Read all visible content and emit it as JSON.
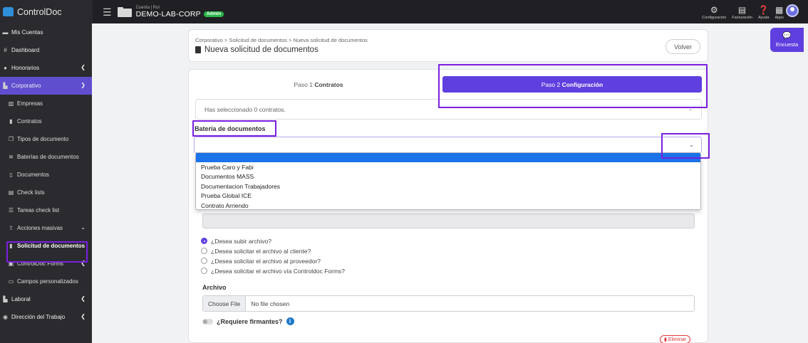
{
  "topbar": {
    "brand": "ControlDoc",
    "account_role": "Cuenta | Rol",
    "account_name": "DEMO-LAB-CORP",
    "account_badge": "Admin",
    "actions": [
      {
        "label": "Configuración",
        "icon": "gears-icon"
      },
      {
        "label": "Facturación",
        "icon": "invoice-icon"
      },
      {
        "label": "Ayuda",
        "icon": "help-icon"
      },
      {
        "label": "Apps",
        "icon": "grid-icon"
      }
    ]
  },
  "sidebar": {
    "items": [
      {
        "label": "Mis Cuentas"
      },
      {
        "label": "Dashboard"
      },
      {
        "label": "Honorarios"
      },
      {
        "label": "Corporativo"
      },
      {
        "label": "Empresas"
      },
      {
        "label": "Contratos"
      },
      {
        "label": "Tipos de documento"
      },
      {
        "label": "Baterías de documentos"
      },
      {
        "label": "Documentos"
      },
      {
        "label": "Check lists"
      },
      {
        "label": "Tareas check list"
      },
      {
        "label": "Acciones masivas"
      },
      {
        "label": "Solicitud de documentos"
      },
      {
        "label": "ControlDoc Forms"
      },
      {
        "label": "Campos personalizados"
      },
      {
        "label": "Laboral"
      },
      {
        "label": "Dirección del Trabajo"
      }
    ]
  },
  "header": {
    "breadcrumb": "Corporativo  >  Solicitud de documentos  >  Nueva solicitud de documentos",
    "title": "Nueva solicitud de documentos",
    "back_button": "Volver"
  },
  "steps": {
    "step1_prefix": "Paso 1",
    "step1_label": "Contratos",
    "step2_prefix": "Paso 2",
    "step2_label": "Configuración"
  },
  "form": {
    "selected_text": "Has seleccionado 0 contratos.",
    "bateria_label": "Batería de documentos",
    "bateria_options": [
      "Prueba Caro y Fabi",
      "Documentos MASS",
      "Documentacion Trabajadores",
      "Prueba Global ICE",
      "Contrato Arriendo"
    ],
    "radio_options": [
      "¿Desea subir archivo?",
      "¿Desea solicitar el archivo al cliente?",
      "¿Desea solicitar el archivo al proveedor?",
      "¿Desea solicitar el archivo vía Controldoc Forms?"
    ],
    "archivo_label": "Archivo",
    "file_button": "Choose File",
    "file_status": "No file chosen",
    "firmantes_label": "¿Requiere firmantes?",
    "delete_button": "Eliminar"
  },
  "survey": {
    "label": "Encuesta"
  },
  "colors": {
    "accent": "#5f3fe0",
    "highlight": "#7a1fe0",
    "sidebar_bg": "#2b2b2f"
  }
}
